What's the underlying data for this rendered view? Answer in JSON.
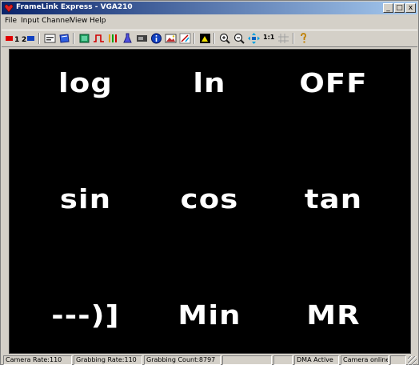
{
  "window": {
    "title": "FrameLink Express - VGA210",
    "icon": "framelink-app-icon",
    "controls": {
      "minimize": "_",
      "maximize": "□",
      "close": "x"
    }
  },
  "menu": {
    "items": [
      "File",
      "Input Channel",
      "View",
      "Help"
    ]
  },
  "toolbar": {
    "channel1": "1",
    "channel2": "2",
    "zoom_label": "1:1",
    "icons": [
      "channel-1-icon",
      "channel-2-icon",
      "tiff-icon",
      "camera-select-icon",
      "frame-icon",
      "pulse-icon",
      "bars-icon",
      "flask-icon",
      "card-icon",
      "info-icon",
      "image-icon",
      "wand-icon",
      "histogram-icon",
      "zoom-in-icon",
      "zoom-out-icon",
      "fit-icon",
      "grid-icon",
      "help-icon"
    ]
  },
  "display": {
    "background": "#000000",
    "symbols": [
      [
        "log",
        "ln",
        "OFF"
      ],
      [
        "sin",
        "cos",
        "tan"
      ],
      [
        "---)]",
        "Min",
        "MR"
      ]
    ]
  },
  "status": {
    "camera_rate": "Camera Rate:110",
    "grabbing_rate": "Grabbing Rate:110",
    "grabbing_count": "Grabbing Count:8797",
    "dma": "DMA Active",
    "camera": "Camera online"
  }
}
